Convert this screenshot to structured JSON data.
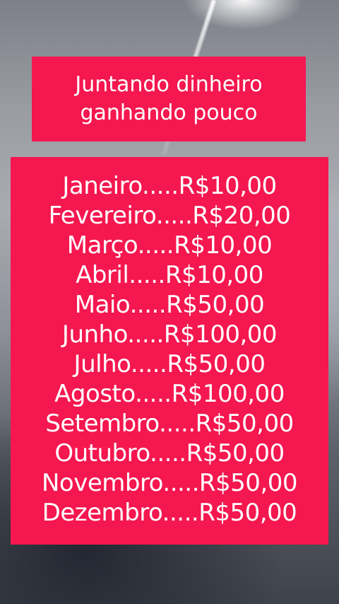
{
  "title": {
    "line1": "Juntando dinheiro",
    "line2": "ganhando pouco"
  },
  "months": [
    "Janeiro.....R$10,00",
    "Fevereiro.....R$20,00",
    "Março.....R$10,00",
    "Abril.....R$10,00",
    "Maio.....R$50,00",
    "Junho.....R$100,00",
    "Julho.....R$50,00",
    "Agosto.....R$100,00",
    "Setembro.....R$50,00",
    "Outubro.....R$50,00",
    "Novembro.....R$50,00",
    "Dezembro.....R$50,00"
  ],
  "colors": {
    "box": "#f5174f",
    "text": "#ffffff"
  }
}
